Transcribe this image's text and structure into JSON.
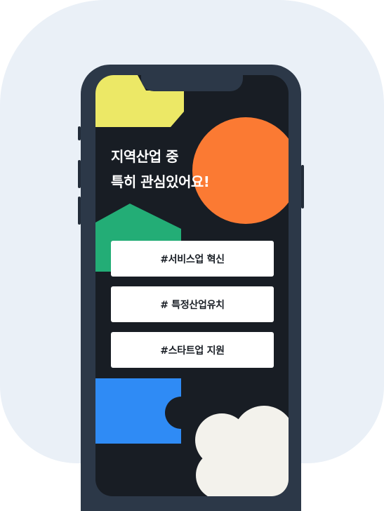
{
  "headline": {
    "line1": "지역산업 중",
    "line2": "특히 관심있어요!"
  },
  "options": [
    {
      "label": "#서비스업 혁신"
    },
    {
      "label": "# 특정산업유치"
    },
    {
      "label": "#스타트업 지원"
    }
  ],
  "colors": {
    "backdrop": "#eaf0f7",
    "phone_frame": "#2c3848",
    "screen": "#181d24",
    "yellow": "#ece866",
    "orange": "#fb7a33",
    "green": "#23ad76",
    "blue": "#2f8bf5",
    "cream": "#f3f2ec"
  }
}
